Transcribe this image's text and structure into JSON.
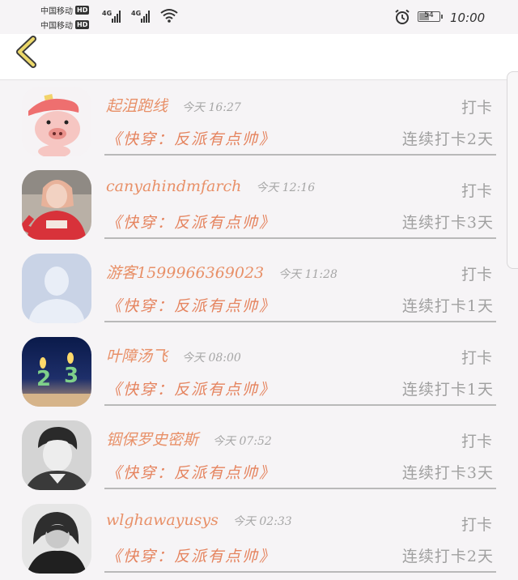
{
  "status_bar": {
    "carrier_1": "中国移动",
    "carrier_2": "中国移动",
    "hd_badge": "HD",
    "network_1": "4G",
    "network_2": "4G",
    "battery_level": "54",
    "time": "10:00"
  },
  "checkins": [
    {
      "name": "起沮跑线",
      "time": "今天  16:27",
      "action": "打卡",
      "book": "《快穿：反派有点帅》",
      "streak": "连续打卡2天",
      "avatar_icon": "cartoon-pig-avatar"
    },
    {
      "name": "canyahindmfarch",
      "time": "今天  12:16",
      "action": "打卡",
      "book": "《快穿：反派有点帅》",
      "streak": "连续打卡3天",
      "avatar_icon": "girl-red-sweater-avatar"
    },
    {
      "name": "游客1599966369023",
      "time": "今天  11:28",
      "action": "打卡",
      "book": "《快穿：反派有点帅》",
      "streak": "连续打卡1天",
      "avatar_icon": "default-user-avatar"
    },
    {
      "name": "叶障汤飞",
      "time": "今天  08:00",
      "action": "打卡",
      "book": "《快穿：反派有点帅》",
      "streak": "连续打卡1天",
      "avatar_icon": "birthday-candles-avatar"
    },
    {
      "name": "铟保罗史密斯",
      "time": "今天  07:52",
      "action": "打卡",
      "book": "《快穿：反派有点帅》",
      "streak": "连续打卡3天",
      "avatar_icon": "boy-portrait-avatar"
    },
    {
      "name": "wlghawayusys",
      "time": "今天  02:33",
      "action": "打卡",
      "book": "《快穿：反派有点帅》",
      "streak": "连续打卡2天",
      "avatar_icon": "girl-bw-portrait-avatar"
    }
  ],
  "colors": {
    "accent": "#e5845f",
    "muted": "#a0a0a0",
    "back_arrow": "#ecd86a"
  }
}
